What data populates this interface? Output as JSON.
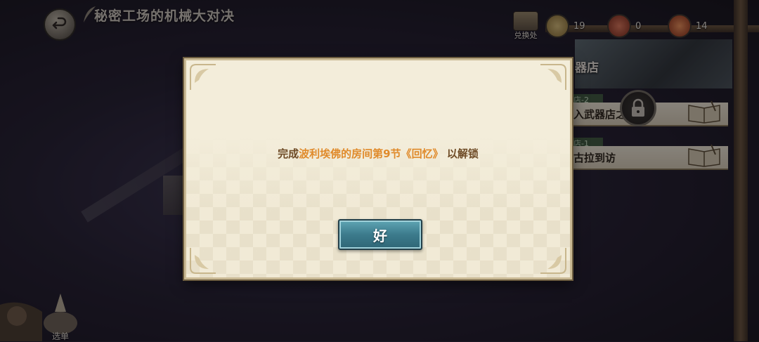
{
  "header": {
    "title": "秘密工场的机械大对决"
  },
  "currency": {
    "exchange_label": "兑换处",
    "items": [
      {
        "icon": "gear-coin-icon",
        "count": "19",
        "color": "#b89a4a"
      },
      {
        "icon": "red-token-icon",
        "count": "0",
        "color": "#b8452e"
      },
      {
        "icon": "ticket-token-icon",
        "count": "14",
        "color": "#c4532c"
      }
    ]
  },
  "panel": {
    "title": "器店",
    "rows": [
      {
        "tab": "店-2",
        "label": "入武器店之",
        "locked": true
      },
      {
        "tab": "店-1",
        "label": "古拉到访",
        "locked": false
      }
    ]
  },
  "bottom_menu": {
    "label": "选单"
  },
  "modal": {
    "message_prefix": "完成",
    "message_highlight": "波利埃佛的房间第9节《回忆》",
    "message_suffix": "以解锁",
    "ok_label": "好"
  }
}
